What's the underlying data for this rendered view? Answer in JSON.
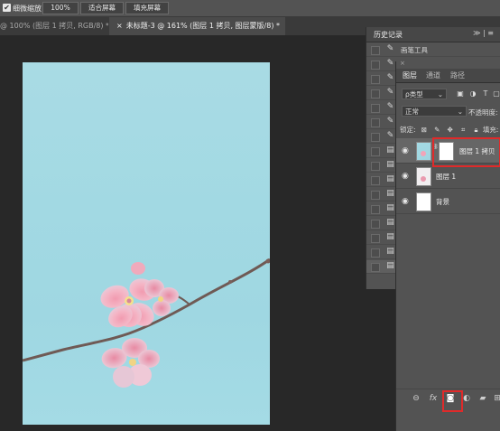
{
  "options_bar": {
    "checkbox_label": "细微缩放",
    "zoom_value": "100%",
    "fit_screen_label": "适合屏幕",
    "fill_screen_label": "填充屏幕"
  },
  "doc_tabs": [
    {
      "label": "@ 100% (图层 1 拷贝, RGB/8) *"
    },
    {
      "label": "未标题-3 @ 161% (图层 1 拷贝, 图层蒙版/8) *"
    }
  ],
  "history": {
    "title": "历史记录",
    "controls": "≫ | ≡",
    "first_item": "画笔工具",
    "item_icons": [
      "brush-icon",
      "brush-icon",
      "brush-icon",
      "brush-icon",
      "brush-icon",
      "brush-icon",
      "brush-icon",
      "document-icon",
      "document-icon",
      "document-icon",
      "document-icon",
      "document-icon",
      "document-icon",
      "document-icon",
      "document-icon",
      "document-icon"
    ]
  },
  "layers_panel": {
    "tabs": [
      "图层",
      "通道",
      "路径"
    ],
    "filter_label": "ρ类型",
    "blend_mode": "正常",
    "opacity_label": "不透明度:",
    "lock_label": "锁定:",
    "fill_label": "填充:",
    "layers": [
      {
        "name": "图层 1 拷贝",
        "selected": true
      },
      {
        "name": "图层 1",
        "selected": false
      },
      {
        "name": "背景",
        "selected": false
      }
    ],
    "footer_icons": [
      "link-icon",
      "fx-icon",
      "add-mask-icon",
      "adjustment-icon",
      "folder-icon",
      "new-layer-icon"
    ]
  },
  "colors": {
    "highlight": "#e02a2a",
    "canvas_sky": "#a2d9e3",
    "panel_bg": "#535353"
  }
}
